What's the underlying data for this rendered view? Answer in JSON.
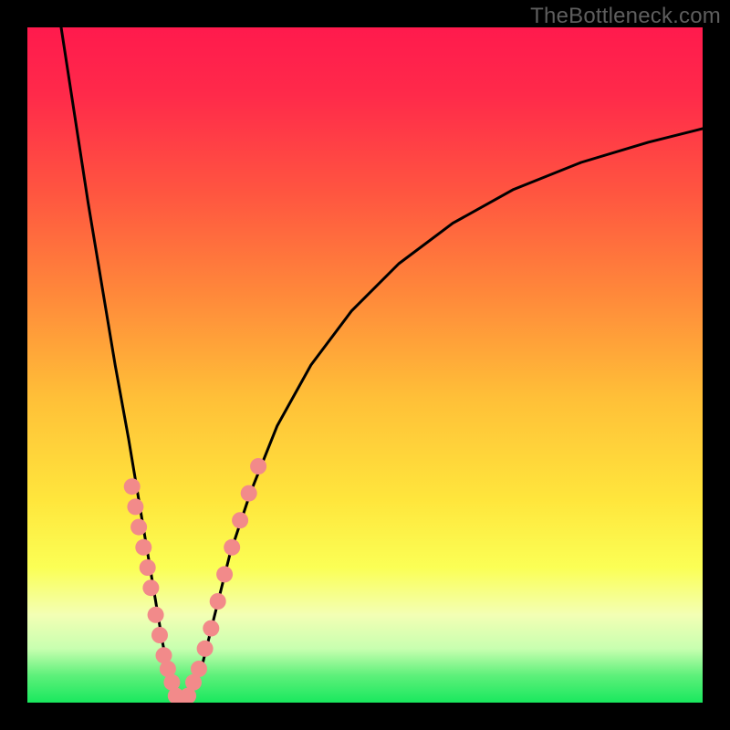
{
  "watermark": "TheBottleneck.com",
  "colors": {
    "frame": "#000000",
    "curve": "#000000",
    "dot_fill": "#f28a8a",
    "dot_stroke": "#8a3a3a",
    "gradient_top": "#ff1a4d",
    "gradient_bottom": "#19e85e"
  },
  "chart_data": {
    "type": "line",
    "title": "",
    "subtitle": "",
    "xlabel": "",
    "ylabel": "",
    "xlim": [
      0,
      100
    ],
    "ylim": [
      0,
      100
    ],
    "grid": false,
    "notes": "V-shaped bottleneck curve. y=0 is best (green), y=100 is worst (red). Curve minimum is near x≈22, y≈0. Pink dots mark sample points clustered near the trough on both branches.",
    "series": [
      {
        "name": "bottleneck-curve",
        "kind": "line",
        "x": [
          5,
          7,
          9,
          11,
          13,
          15,
          16,
          17,
          18,
          19,
          20,
          21,
          22,
          23,
          24,
          25,
          26,
          27,
          28,
          30,
          33,
          37,
          42,
          48,
          55,
          63,
          72,
          82,
          92,
          100
        ],
        "y": [
          100,
          87,
          74,
          62,
          50,
          39,
          33,
          27,
          21,
          15,
          9,
          4,
          1,
          0,
          1,
          3,
          6,
          10,
          14,
          22,
          31,
          41,
          50,
          58,
          65,
          71,
          76,
          80,
          83,
          85
        ]
      },
      {
        "name": "left-branch-dots",
        "kind": "scatter",
        "x": [
          15.5,
          16.0,
          16.5,
          17.2,
          17.8,
          18.3,
          19.0,
          19.6,
          20.2,
          20.8,
          21.4,
          22.0
        ],
        "y": [
          32,
          29,
          26,
          23,
          20,
          17,
          13,
          10,
          7,
          5,
          3,
          1
        ]
      },
      {
        "name": "right-branch-dots",
        "kind": "scatter",
        "x": [
          23.0,
          23.8,
          24.6,
          25.4,
          26.3,
          27.2,
          28.2,
          29.2,
          30.3,
          31.5,
          32.8,
          34.2
        ],
        "y": [
          0,
          1,
          3,
          5,
          8,
          11,
          15,
          19,
          23,
          27,
          31,
          35
        ]
      }
    ]
  }
}
